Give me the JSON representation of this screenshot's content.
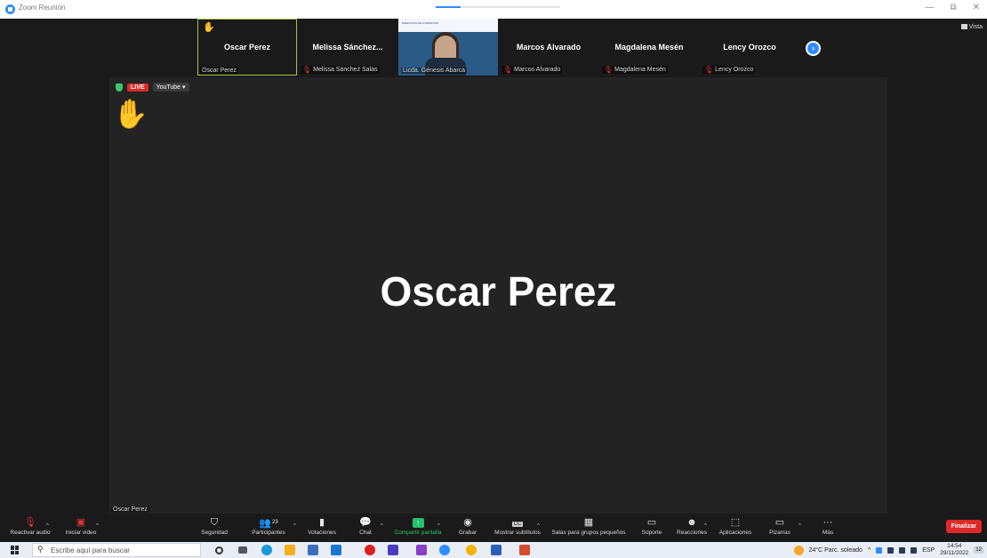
{
  "window": {
    "title": "Zoom Reunión",
    "controls": [
      "—",
      "⧉",
      "✕"
    ]
  },
  "view_button": "Vista",
  "gallery": [
    {
      "name": "Oscar Perez",
      "label": "Oscar Perez",
      "muted": false,
      "raised_hand": true,
      "active": true
    },
    {
      "name": "Melissa Sánchez...",
      "label": "Melissa Sánchez Salas",
      "muted": true
    },
    {
      "video": true,
      "label": "Licda. Génesis Abarca",
      "banner_text": "DIRECCIÓN DE FORMACIÓN"
    },
    {
      "name": "Marcos Alvarado",
      "label": "Marcos Alvarado",
      "muted": true
    },
    {
      "name": "Magdalena Mesén",
      "label": "Magdalena Mesén",
      "muted": true
    },
    {
      "name": "Lency Orozco",
      "label": "Lency Orozco",
      "muted": true
    }
  ],
  "main_video": {
    "speaker_name": "Oscar Perez",
    "label": "Oscar Perez",
    "live_badge": "LIVE",
    "stream_target": "YouTube ▾"
  },
  "toolbar": {
    "audio": "Reactivar audio",
    "video": "Iniciar video",
    "security": "Seguridad",
    "participants": "Participantes",
    "participant_count": "23",
    "polls": "Votaciones",
    "chat": "Chat",
    "share": "Compartir pantalla",
    "record": "Grabar",
    "captions": "Mostrar subtítulos",
    "breakout": "Salas para grupos pequeños",
    "support": "Soporte",
    "reactions": "Reacciones",
    "apps": "Aplicaciones",
    "whiteboards": "Pizarras",
    "more": "Más",
    "end": "Finalizar",
    "cc_icon": "CC"
  },
  "taskbar": {
    "search_placeholder": "Escribe aquí para buscar",
    "weather": "24°C  Parc. soleado",
    "language": "ESP",
    "time": "14:54",
    "date": "29/11/2022",
    "notifications": "12"
  },
  "colors": {
    "accent_blue": "#2d8cff",
    "live_red": "#e02828",
    "share_green": "#23c16b",
    "hand_yellow": "#f5b301",
    "active_border": "#a4c343"
  }
}
